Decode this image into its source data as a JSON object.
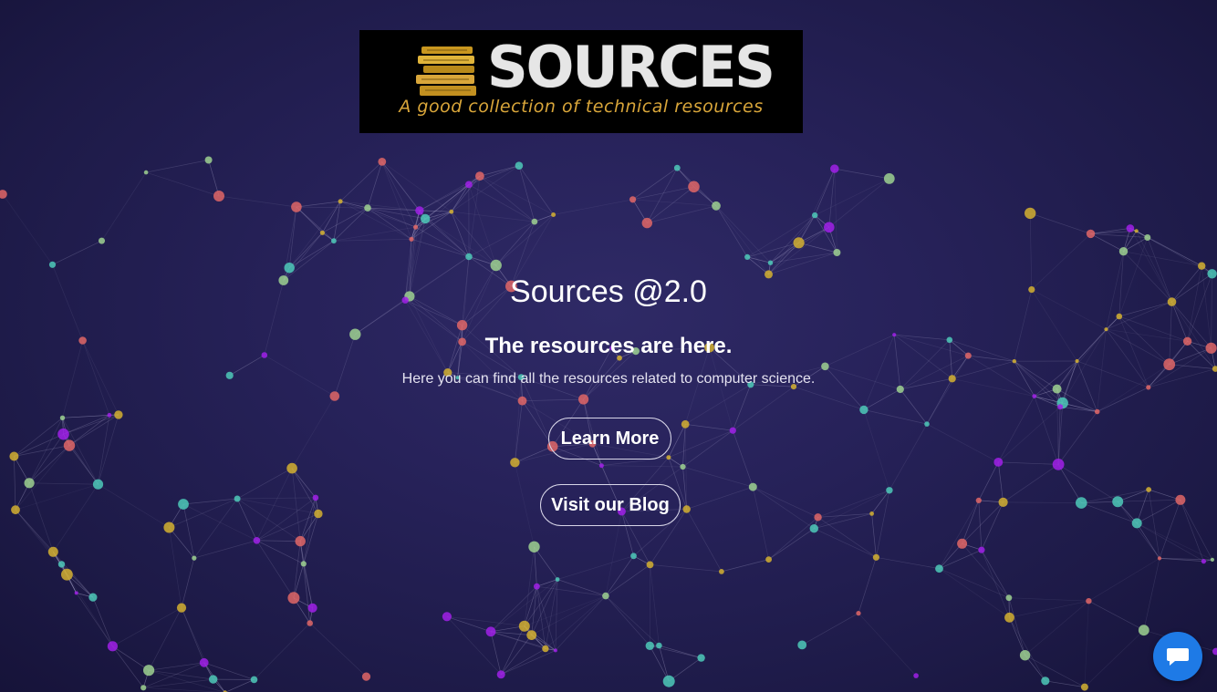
{
  "logo": {
    "word": "SOURCES",
    "tagline": "A good collection of technical resources"
  },
  "hero": {
    "title": "Sources @2.0",
    "subtitle": "The resources are here.",
    "description": "Here you can find all the resources related to computer science."
  },
  "buttons": {
    "learn_more": "Learn More",
    "visit_blog": "Visit our Blog"
  },
  "chat": {
    "icon": "chat-bubble-icon"
  },
  "colors": {
    "background": "#27225a",
    "node_colors": [
      "#e06666",
      "#d4b030",
      "#4ec9b8",
      "#a020e8",
      "#9ed190"
    ],
    "chat_accent": "#1e7ae6",
    "logo_gold": "#d9a63a"
  }
}
